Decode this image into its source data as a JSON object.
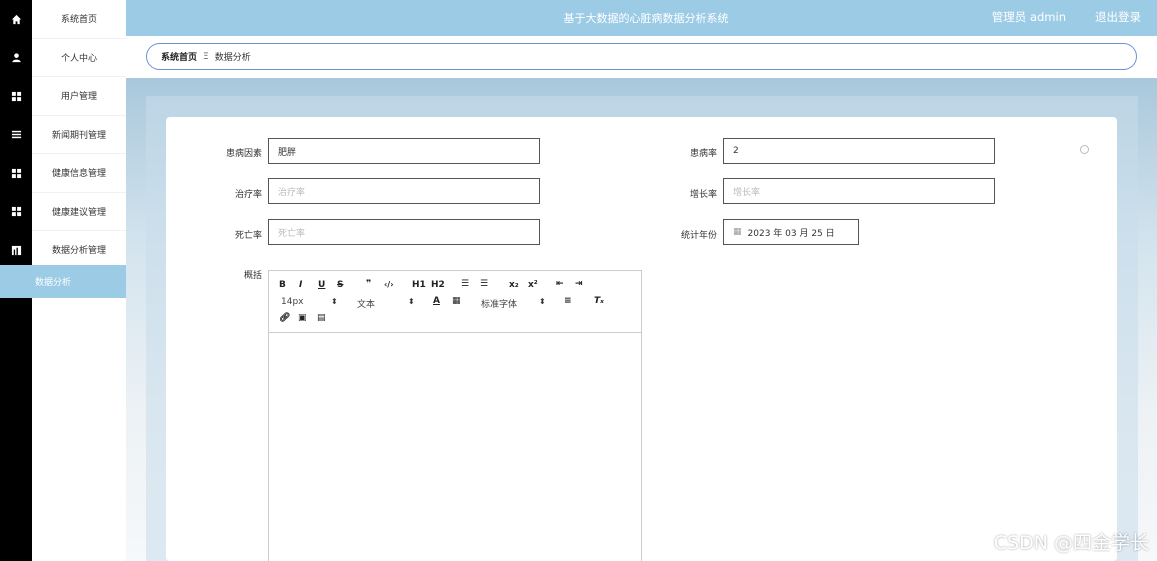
{
  "header": {
    "title": "基于大数据的心脏病数据分析系统",
    "admin": "管理员 admin",
    "logout": "退出登录"
  },
  "rail_icons": [
    "home-icon",
    "user-icon",
    "grid-icon",
    "list-icon",
    "grid-icon",
    "grid-icon",
    "chart-icon"
  ],
  "sidebar": {
    "items": [
      "系统首页",
      "个人中心",
      "用户管理",
      "新闻期刊管理",
      "健康信息管理",
      "健康建议管理",
      "数据分析管理"
    ],
    "submenu": "数据分析"
  },
  "breadcrumb": {
    "home": "系统首页",
    "separator": "Ξ",
    "current": "数据分析"
  },
  "form": {
    "factor_label": "患病因素",
    "factor_value": "肥胖",
    "rate_label": "患病率",
    "rate_value": "2",
    "cure_label": "治疗率",
    "cure_placeholder": "治疗率",
    "growth_label": "增长率",
    "growth_placeholder": "增长率",
    "death_label": "死亡率",
    "death_placeholder": "死亡率",
    "year_label": "统计年份",
    "year_value": "2023 年 03 月 25 日",
    "summary_label": "概括"
  },
  "editor": {
    "font_size": "14px",
    "text_style": "文本",
    "font_family": "标准字体",
    "h1": "H1",
    "h2": "H2"
  },
  "watermark": "CSDN @四金学长"
}
